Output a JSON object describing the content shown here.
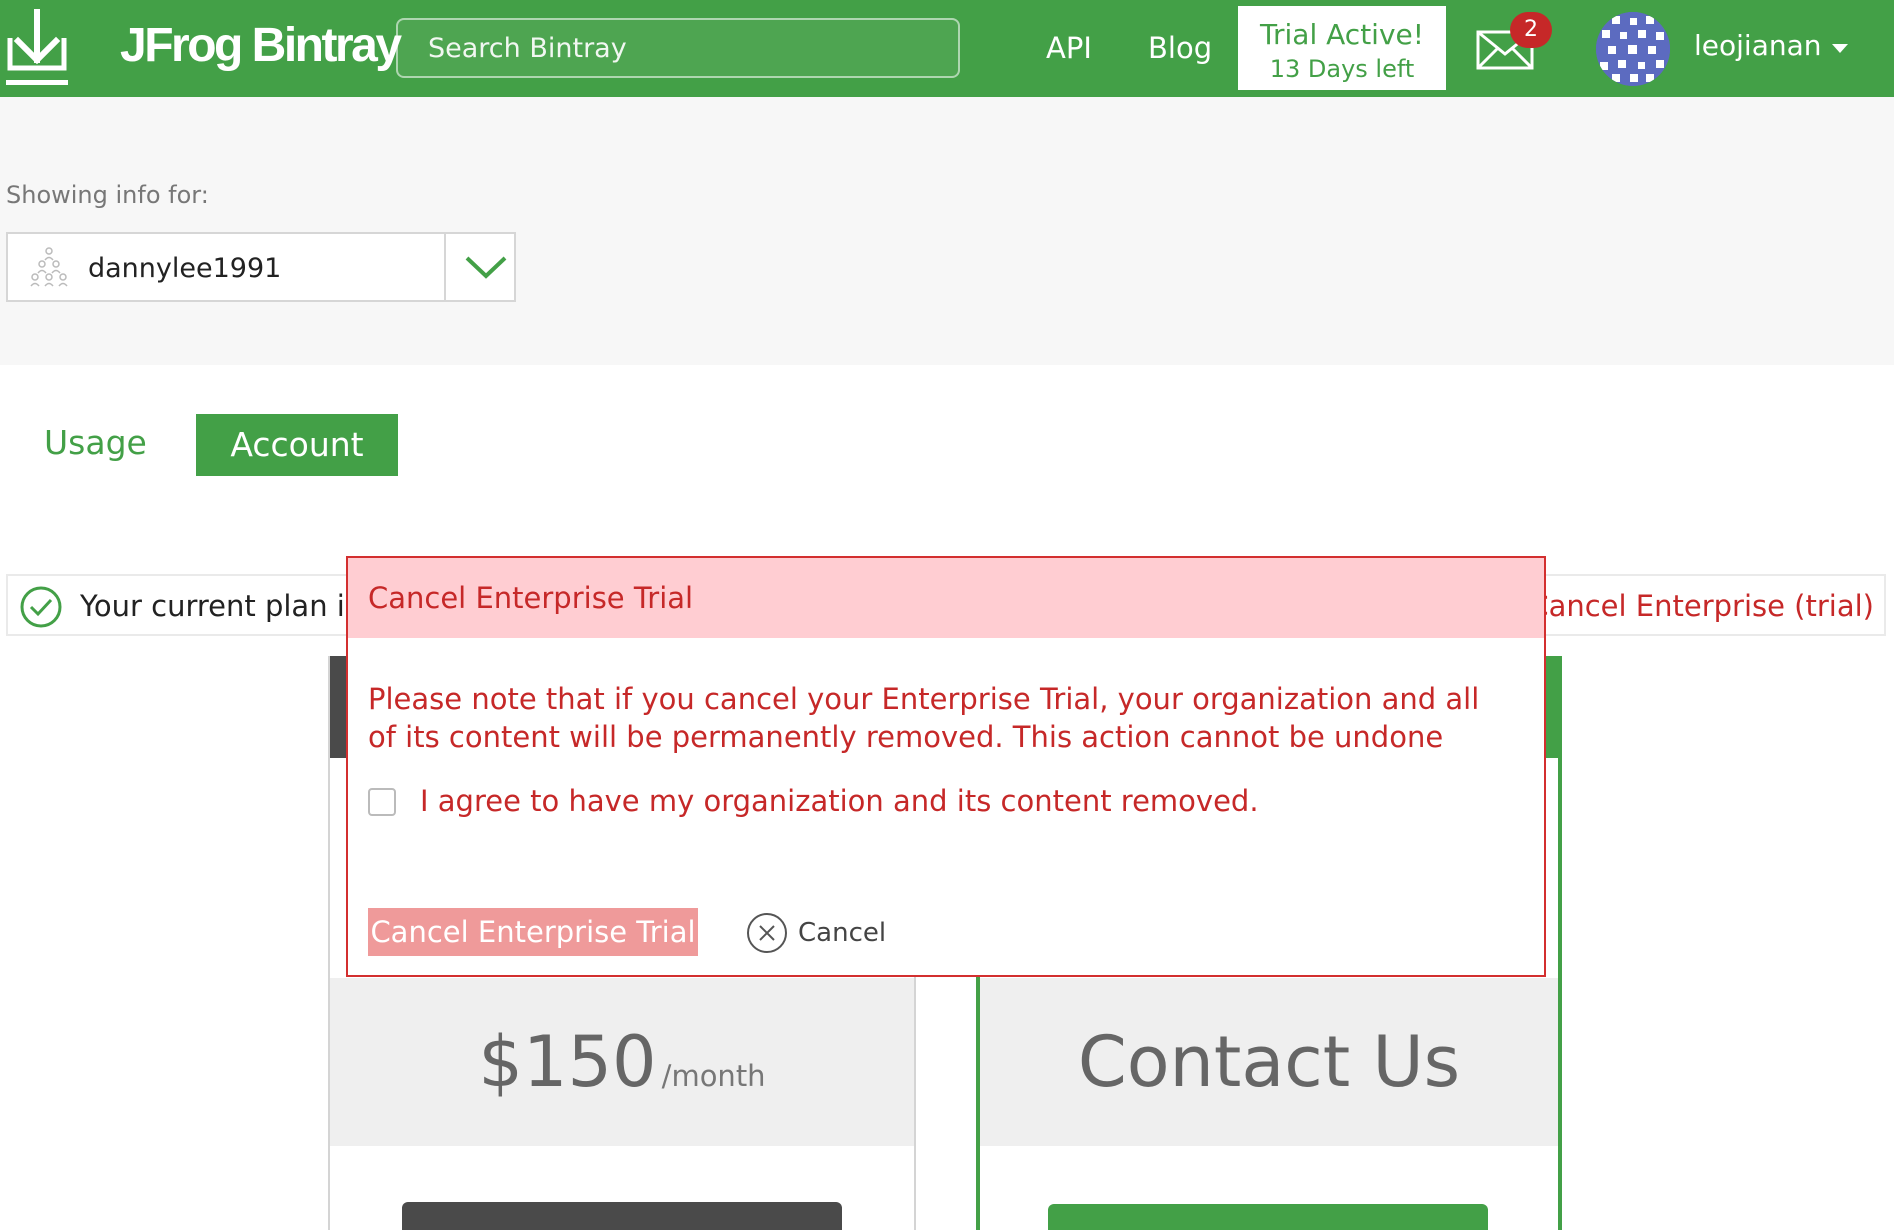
{
  "header": {
    "logo_text": "JFrog Bintray",
    "logo_icon": "download-arrow-icon",
    "search_placeholder": "Search Bintray",
    "nav": [
      {
        "label": "API"
      },
      {
        "label": "Blog"
      }
    ],
    "trial": {
      "line1": "Trial Active!",
      "line2": "13 Days left"
    },
    "messages_icon": "envelope-icon",
    "messages_count": "2",
    "username": "leojianan",
    "brand_color": "#43a047"
  },
  "info": {
    "showing_label": "Showing info for:",
    "org_name": "dannylee1991",
    "org_icon": "organization-people-icon"
  },
  "tabs": [
    {
      "label": "Usage",
      "active": false
    },
    {
      "label": "Account",
      "active": true
    }
  ],
  "plan": {
    "current_text": "Your current plan is E",
    "cancel_link": "Cancel Enterprise (trial)"
  },
  "cards": {
    "left_price": "$150",
    "left_unit": "/month",
    "right_text": "Contact Us"
  },
  "modal": {
    "title": "Cancel Enterprise Trial",
    "warning": "Please note that if you cancel your Enterprise Trial, your organization and all of its content will be permanently removed. This action cannot be undone",
    "agree_label": "I agree to have my organization and its content removed.",
    "agree_checked": false,
    "confirm_button": "Cancel Enterprise Trial",
    "cancel_label": "Cancel",
    "accent_color": "#c62828"
  }
}
